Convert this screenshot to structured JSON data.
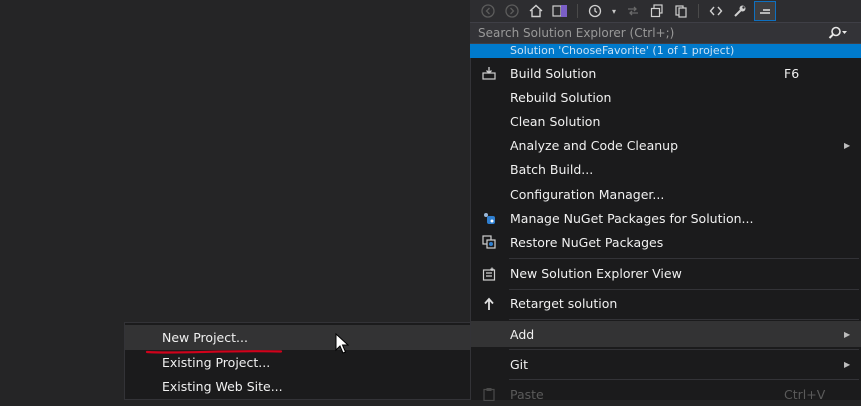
{
  "toolbar": {
    "icons": [
      "back-icon",
      "forward-icon",
      "home-icon",
      "vs-switch-icon",
      "history-icon",
      "chevron-down-icon",
      "sync-icon",
      "collapse-icon",
      "copy-icon",
      "code-icon",
      "wrench-icon",
      "pin-icon"
    ]
  },
  "search": {
    "placeholder": "Search Solution Explorer (Ctrl+;)"
  },
  "selected_row": {
    "text": "Solution 'ChooseFavorite' (1 of 1 project)"
  },
  "menu": {
    "items": [
      {
        "label": "Build Solution",
        "shortcut": "F6",
        "icon": "build-icon"
      },
      {
        "label": "Rebuild Solution"
      },
      {
        "label": "Clean Solution"
      },
      {
        "label": "Analyze and Code Cleanup",
        "has_submenu": true
      },
      {
        "label": "Batch Build..."
      },
      {
        "label": "Configuration Manager..."
      },
      {
        "label": "Manage NuGet Packages for Solution...",
        "icon": "nuget-icon"
      },
      {
        "label": "Restore NuGet Packages",
        "icon": "restore-icon"
      },
      {
        "label": "New Solution Explorer View",
        "icon": "new-view-icon"
      },
      {
        "label": "Retarget solution",
        "icon": "retarget-icon"
      },
      {
        "label": "Add",
        "has_submenu": true,
        "highlighted": true
      },
      {
        "label": "Git",
        "has_submenu": true
      },
      {
        "label": "Paste",
        "shortcut": "Ctrl+V",
        "disabled": true
      }
    ]
  },
  "add_submenu": {
    "items": [
      {
        "label": "New Project...",
        "highlighted": true
      },
      {
        "label": "Existing Project..."
      },
      {
        "label": "Existing Web Site..."
      }
    ]
  },
  "colors": {
    "accent": "#007acc",
    "menu_bg": "#1b1b1c",
    "hover_bg": "#333334",
    "annotation": "#d0021b"
  }
}
